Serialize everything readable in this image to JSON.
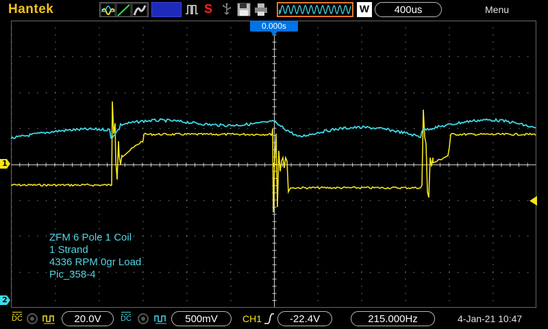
{
  "brand": "Hantek",
  "header": {
    "timebase": "400us",
    "menu_label": "Menu",
    "trigger_mode_letter": "S",
    "waveform_mode_letter": "W"
  },
  "screen": {
    "trigger_position": "0.000s",
    "annotation_lines": [
      "ZFM 6 Pole 1 Coil",
      "1 Strand",
      "4336 RPM 0gr Load",
      "Pic_358-4"
    ],
    "ch1_marker": "1",
    "ch2_marker": "2"
  },
  "footer": {
    "ch1_coupling": "DC",
    "ch1_volts_div": "20.0V",
    "ch2_coupling": "DC",
    "ch2_volts_div": "500mV",
    "trigger_source": "CH1",
    "trigger_level": "-22.4V",
    "frequency": "215.000Hz",
    "date_time": "4-Jan-21 10:47"
  },
  "colors": {
    "ch1": "#f5e51b",
    "ch2": "#3fd8e8",
    "brand": "#f2c21a",
    "trigger_box": "#0073e6"
  }
}
